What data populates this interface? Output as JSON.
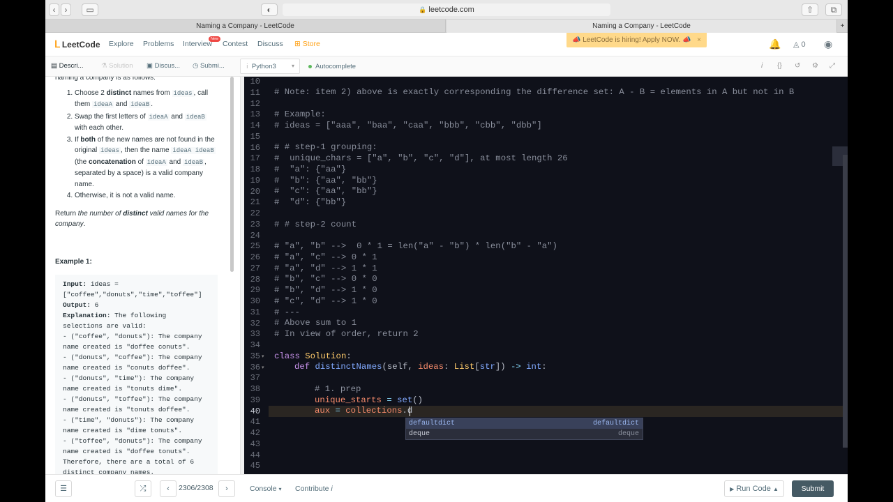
{
  "browser": {
    "url": "leetcode.com",
    "tabs": [
      "Naming a Company - LeetCode",
      "Naming a Company - LeetCode"
    ]
  },
  "nav": {
    "logo": "LeetCode",
    "items": [
      "Explore",
      "Problems",
      "Interview",
      "Contest",
      "Discuss",
      "Store"
    ],
    "new_badge": "New",
    "hiring_banner": "LeetCode is hiring! Apply NOW.",
    "coins": "0"
  },
  "panel_tabs": [
    "Descri...",
    "Solution",
    "Discus...",
    "Submi..."
  ],
  "editor_toolbar": {
    "language": "Python3",
    "autocomplete": "Autocomplete"
  },
  "description": {
    "intro": "naming a company is as follows:",
    "steps": [
      {
        "a": "Choose 2 ",
        "b": "distinct",
        "c": " names from ",
        "code1": "ideas",
        "d": ", call them ",
        "code2": "ideaA",
        "e": " and ",
        "code3": "ideaB",
        "f": "."
      },
      {
        "a": "Swap the first letters of ",
        "code1": "ideaA",
        "b": " and ",
        "code2": "ideaB",
        "c": " with each other."
      },
      {
        "a": "If ",
        "b": "both",
        "c": " of the new names are not found in the original ",
        "code1": "ideas",
        "d": ", then the name ",
        "code2": "ideaA ideaB",
        "e": " (the ",
        "f": "concatenation",
        "g": " of ",
        "code3": "ideaA",
        "h": " and ",
        "code4": "ideaB",
        "i": ", separated by a space) is a valid company name."
      },
      {
        "a": "Otherwise, it is not a valid name."
      }
    ],
    "return_a": "Return ",
    "return_b": "the number of ",
    "return_c": "distinct",
    "return_d": " valid names for the company",
    "return_e": ".",
    "example_title": "Example 1:",
    "example_lines": [
      "Input: ideas =",
      "[\"coffee\",\"donuts\",\"time\",\"toffee\"]",
      "Output: 6",
      "Explanation: The following",
      "selections are valid:",
      "- (\"coffee\", \"donuts\"): The company",
      "name created is \"doffee conuts\".",
      "- (\"donuts\", \"coffee\"): The company",
      "name created is \"conuts doffee\".",
      "- (\"donuts\", \"time\"): The company",
      "name created is \"tonuts dime\".",
      "- (\"donuts\", \"toffee\"): The company",
      "name created is \"tonuts doffee\".",
      "- (\"time\", \"donuts\"): The company",
      "name created is \"dime tonuts\".",
      "- (\"toffee\", \"donuts\"): The company",
      "name created is \"doffee tonuts\".",
      "Therefore, there are a total of 6",
      "distinct company names."
    ]
  },
  "editor": {
    "line_numbers": [
      "10",
      "11",
      "12",
      "13",
      "14",
      "15",
      "16",
      "17",
      "18",
      "19",
      "20",
      "21",
      "22",
      "23",
      "24",
      "25",
      "26",
      "27",
      "28",
      "29",
      "30",
      "31",
      "32",
      "33",
      "34",
      "35",
      "36",
      "37",
      "38",
      "39",
      "40",
      "41",
      "42",
      "43",
      "44",
      "45"
    ],
    "code": {
      "l11": "# Note: item 2) above is exactly corresponding the difference set: A - B = elements in A but not in B",
      "l13": "# Example:",
      "l14": "# ideas = [\"aaa\", \"baa\", \"caa\", \"bbb\", \"cbb\", \"dbb\"]",
      "l16": "# # step-1 grouping:",
      "l17": "#  unique_chars = [\"a\", \"b\", \"c\", \"d\"], at most length 26",
      "l18": "#  \"a\": {\"aa\"}",
      "l19": "#  \"b\": {\"aa\", \"bb\"}",
      "l20": "#  \"c\": {\"aa\", \"bb\"}",
      "l21": "#  \"d\": {\"bb\"}",
      "l23": "# # step-2 count",
      "l25": "# \"a\", \"b\" -->  0 * 1 = len(\"a\" - \"b\") * len(\"b\" - \"a\")",
      "l26": "# \"a\", \"c\" --> 0 * 1",
      "l27": "# \"a\", \"d\" --> 1 * 1",
      "l28": "# \"b\", \"c\" --> 0 * 0",
      "l29": "# \"b\", \"d\" --> 1 * 0",
      "l30": "# \"c\", \"d\" --> 1 * 0",
      "l31": "# ---",
      "l32": "# Above sum to 1",
      "l33": "# In view of order, return 2",
      "l35_kw": "class",
      "l35_name": " Solution",
      "l35_end": ":",
      "l36_kw": "def",
      "l36_fn": " distinctNames",
      "l36_a": "(self, ",
      "l36_param": "ideas",
      "l36_b": ": ",
      "l36_type": "List",
      "l36_c": "[",
      "l36_str": "str",
      "l36_d": "]) ",
      "l36_arrow": "->",
      "l36_int": " int",
      "l36_e": ":",
      "l38": "# 1. prep",
      "l39_var": "unique_starts",
      "l39_op": " = ",
      "l39_fn": "set",
      "l39_end": "()",
      "l40_var": "aux",
      "l40_op": " = ",
      "l40_mod": "collections",
      "l40_end": ".d"
    },
    "autocomplete": [
      {
        "label": "defaultdict",
        "meta": "defaultdict"
      },
      {
        "label": "deque",
        "meta": "deque"
      }
    ]
  },
  "bottom": {
    "counter": "2306/2308",
    "console": "Console",
    "contribute": "Contribute",
    "run_code": "Run Code",
    "submit": "Submit"
  }
}
